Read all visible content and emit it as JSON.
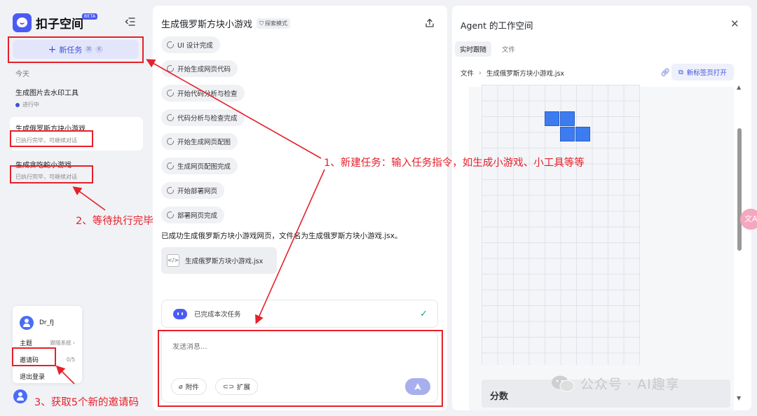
{
  "sidebar": {
    "brand_name": "扣子空间",
    "beta": "BETA",
    "new_task_label": "新任务",
    "new_task_kbd": [
      "⌘",
      "K"
    ],
    "section_today": "今天",
    "tasks": [
      {
        "title": "生成图片去水印工具",
        "status": "进行中"
      },
      {
        "title": "生成俄罗斯方块小游戏",
        "status": "已执行完毕，可继续对话"
      },
      {
        "title": "生成贪吃蛇小游戏",
        "status": "已执行完毕，可继续对话"
      }
    ],
    "user": {
      "name": "Dr_fJ",
      "theme_label": "主题",
      "theme_value": "跟随系统",
      "invite_label": "邀请码",
      "invite_count": "0/5",
      "logout_label": "退出登录"
    }
  },
  "chat": {
    "title": "生成俄罗斯方块小游戏",
    "mode_badge": "探索模式",
    "steps": [
      "UI 设计完成",
      "开始生成网页代码",
      "开始代码分析与检查",
      "代码分析与检查完成",
      "开始生成网页配图",
      "生成网页配图完成",
      "开始部署网页",
      "部署网页完成"
    ],
    "result_text": "已成功生成俄罗斯方块小游戏网页，文件名为生成俄罗斯方块小游戏.jsx。",
    "file_name": "生成俄罗斯方块小游戏.jsx",
    "done_label": "已完成本次任务",
    "input_placeholder": "发送消息...",
    "attach_label": "附件",
    "extend_label": "扩展"
  },
  "workspace": {
    "title": "Agent 的工作空间",
    "tabs": [
      "实时跟随",
      "文件"
    ],
    "path_root": "文件",
    "path_file": "生成俄罗斯方块小游戏.jsx",
    "open_new_tab": "新标签页打开",
    "score_label": "分数"
  },
  "watermark": "公众号 · AI趣享",
  "annotations": {
    "a1": "1、新建任务：输入任务指令，如生成小游戏、小工具等等",
    "a2": "2、等待执行完毕",
    "a3": "3、获取5个新的邀请码"
  },
  "colors": {
    "accent": "#4a5bf5",
    "annotation": "#e6202a",
    "tetromino": "#3d7cf0"
  }
}
